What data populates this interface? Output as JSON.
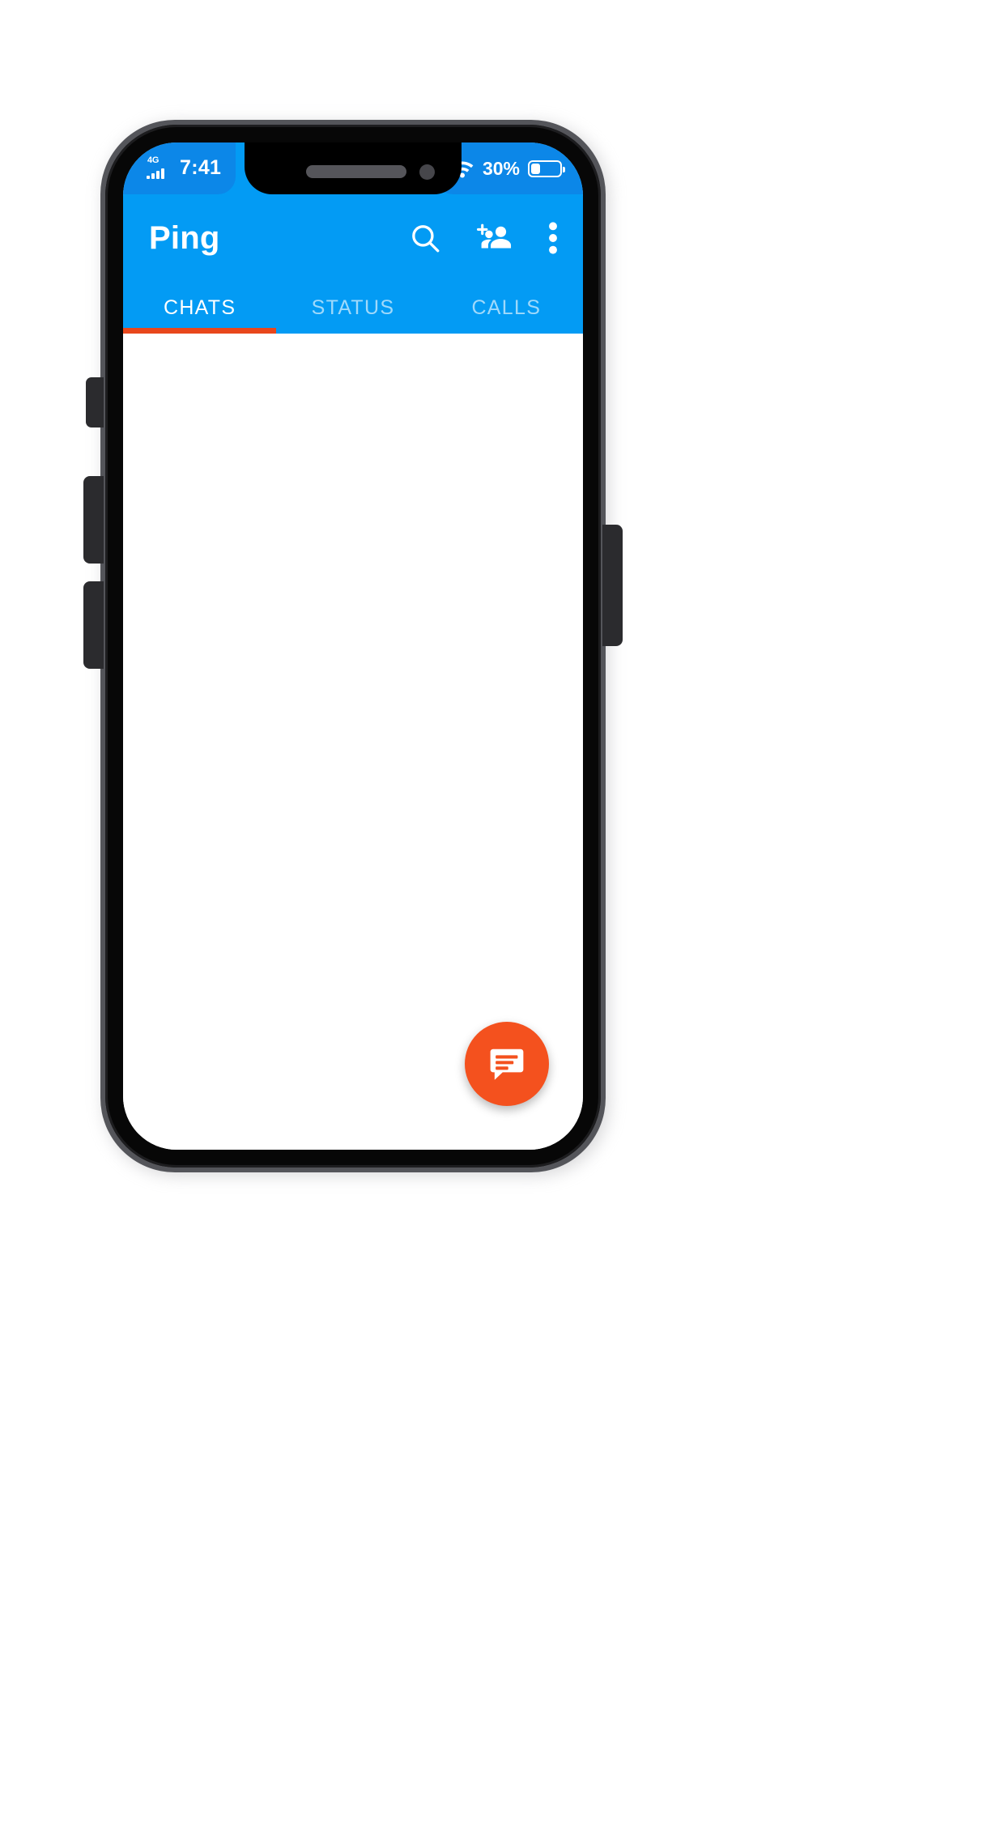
{
  "device": {
    "frame": "smartphone-notch",
    "notch": {
      "speaker": "speaker-grille",
      "camera": "front-camera"
    },
    "buttons": [
      "mute-switch",
      "volume-up",
      "volume-down",
      "power"
    ]
  },
  "status_bar": {
    "network_label": "4G",
    "signal_icon": "signal-bars-icon",
    "time": "7:41",
    "wifi_icon": "wifi-icon",
    "battery_percent": "30%",
    "battery_level": 30,
    "battery_icon": "battery-icon",
    "background_color": "#0C87E8"
  },
  "app_bar": {
    "title": "Ping",
    "background_color": "#039BF4",
    "actions": [
      {
        "name": "search-icon",
        "label": "Search"
      },
      {
        "name": "add-people-icon",
        "label": "New group"
      },
      {
        "name": "overflow-menu-icon",
        "label": "More options"
      }
    ]
  },
  "tabs": {
    "items": [
      {
        "label": "CHATS",
        "active": true
      },
      {
        "label": "STATUS",
        "active": false
      },
      {
        "label": "CALLS",
        "active": false
      }
    ],
    "indicator_color": "#E8471C",
    "active_index": 0
  },
  "content": {
    "background_color": "#FFFFFF",
    "empty": true
  },
  "fab": {
    "name": "new-chat-fab",
    "label": "New chat",
    "icon": "chat-bubble-icon",
    "background_color": "#F4511E"
  }
}
